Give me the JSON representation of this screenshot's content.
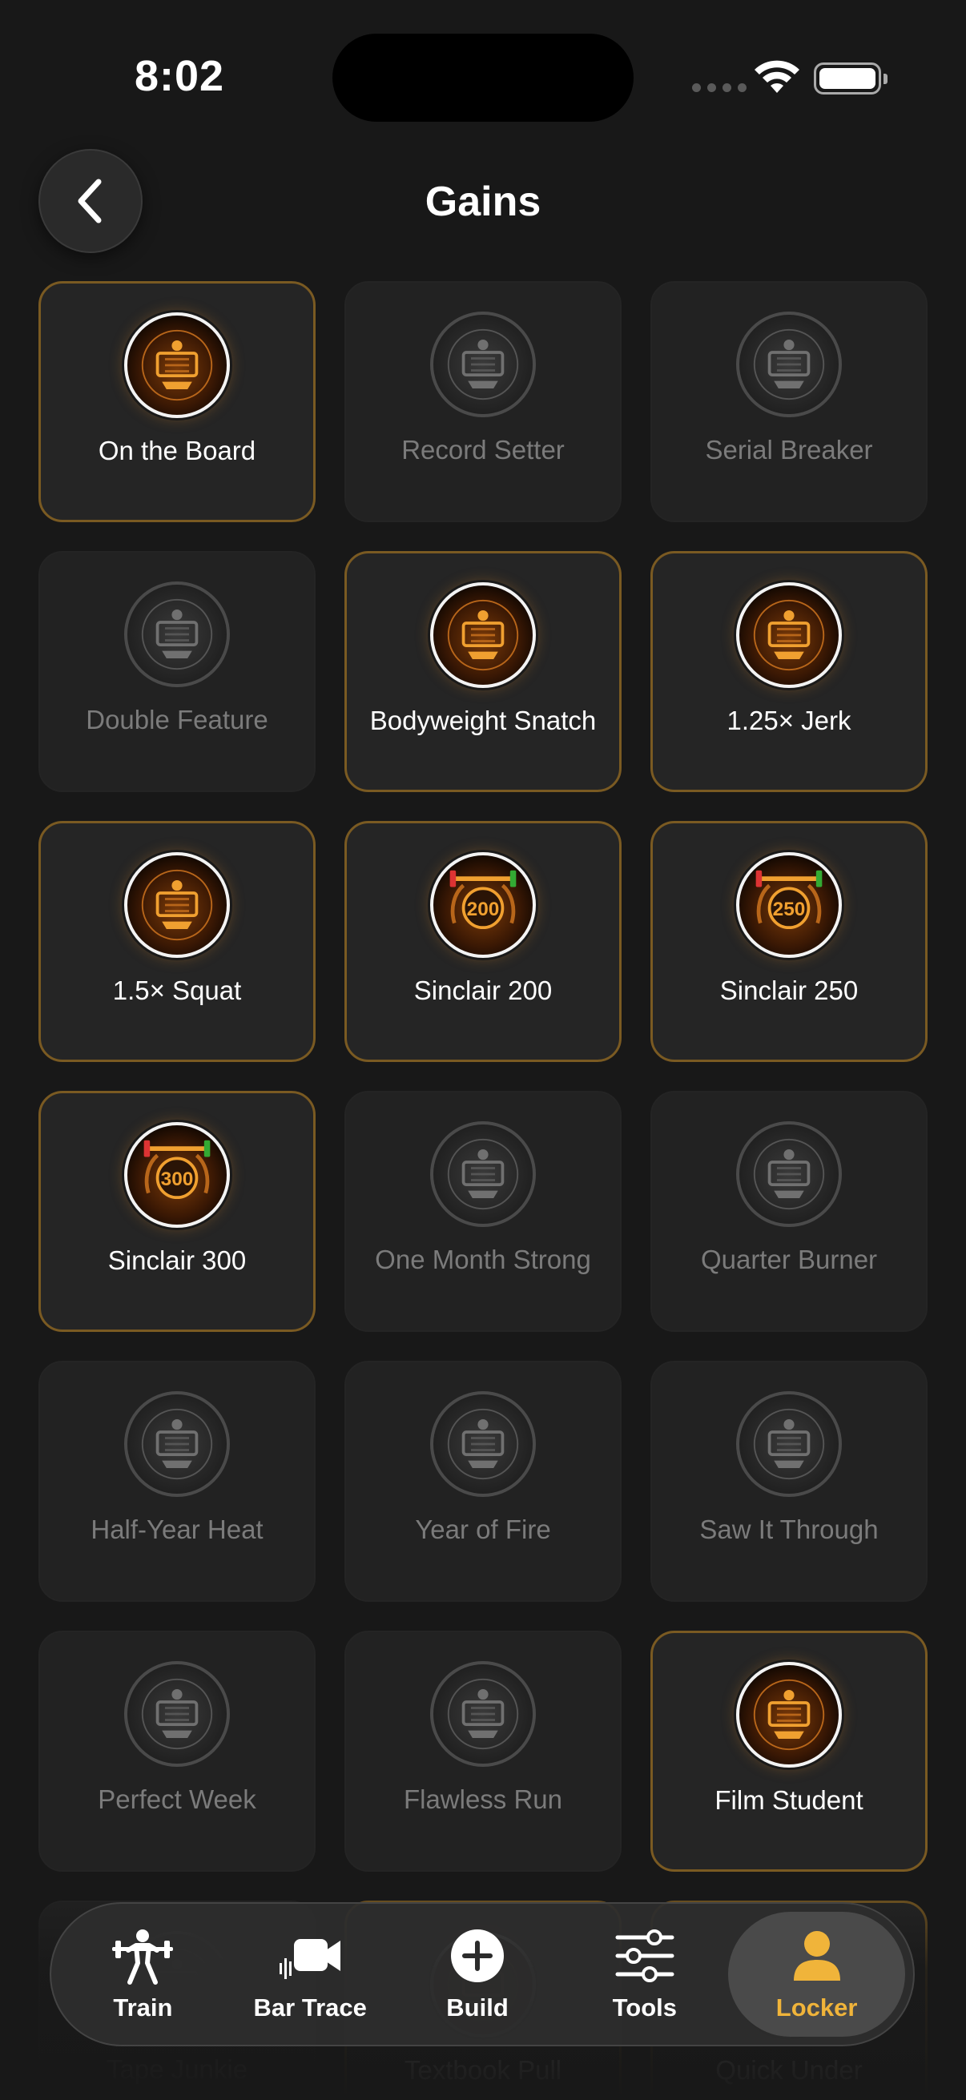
{
  "status_bar": {
    "time": "8:02"
  },
  "header": {
    "title": "Gains",
    "back_icon": "chevron-left-icon"
  },
  "colors": {
    "accent": "#f0b43a",
    "unlocked_border": "#7a5a22",
    "badge_glow": "#e8881e"
  },
  "achievements": [
    {
      "name": "On the Board",
      "unlocked": true,
      "icon": "barbell-board-icon"
    },
    {
      "name": "Record Setter",
      "unlocked": false,
      "icon": "record-board-icon"
    },
    {
      "name": "Serial Breaker",
      "unlocked": false,
      "icon": "grid-board-icon"
    },
    {
      "name": "Double Feature",
      "unlocked": false,
      "icon": "double-check-icon"
    },
    {
      "name": "Bodyweight Snatch",
      "unlocked": true,
      "icon": "snatch-lifter-icon"
    },
    {
      "name": "1.25× Jerk",
      "unlocked": true,
      "icon": "jerk-lifter-icon"
    },
    {
      "name": "1.5× Squat",
      "unlocked": true,
      "icon": "squat-lifter-icon"
    },
    {
      "name": "Sinclair 200",
      "unlocked": true,
      "icon": "laurel-200-icon",
      "badge_text": "200"
    },
    {
      "name": "Sinclair 250",
      "unlocked": true,
      "icon": "laurel-250-icon",
      "badge_text": "250"
    },
    {
      "name": "Sinclair 300",
      "unlocked": true,
      "icon": "laurel-300-icon",
      "badge_text": "300"
    },
    {
      "name": "One Month Strong",
      "unlocked": false,
      "icon": "flame-icon"
    },
    {
      "name": "Quarter Burner",
      "unlocked": false,
      "icon": "flame-grid-icon"
    },
    {
      "name": "Half-Year Heat",
      "unlocked": false,
      "icon": "flame-calendar-icon"
    },
    {
      "name": "Year of Fire",
      "unlocked": false,
      "icon": "flame-year-icon"
    },
    {
      "name": "Saw It Through",
      "unlocked": false,
      "icon": "clipboard-check-icon"
    },
    {
      "name": "Perfect Week",
      "unlocked": false,
      "icon": "perfect-week-icon"
    },
    {
      "name": "Flawless Run",
      "unlocked": false,
      "icon": "shield-check-icon"
    },
    {
      "name": "Film Student",
      "unlocked": true,
      "icon": "film-icon"
    },
    {
      "name": "Tape Junkie",
      "unlocked": false,
      "icon": "tape-icon"
    },
    {
      "name": "Textbook Pull",
      "unlocked": true,
      "icon": "pull-icon"
    },
    {
      "name": "Quick Under",
      "unlocked": true,
      "icon": "quick-under-icon"
    }
  ],
  "tab_bar": [
    {
      "label": "Train",
      "icon": "barbell-lifter-icon",
      "active": false
    },
    {
      "label": "Bar Trace",
      "icon": "video-camera-icon",
      "active": false
    },
    {
      "label": "Build",
      "icon": "plus-circle-icon",
      "active": false
    },
    {
      "label": "Tools",
      "icon": "sliders-icon",
      "active": false
    },
    {
      "label": "Locker",
      "icon": "person-icon",
      "active": true
    }
  ]
}
